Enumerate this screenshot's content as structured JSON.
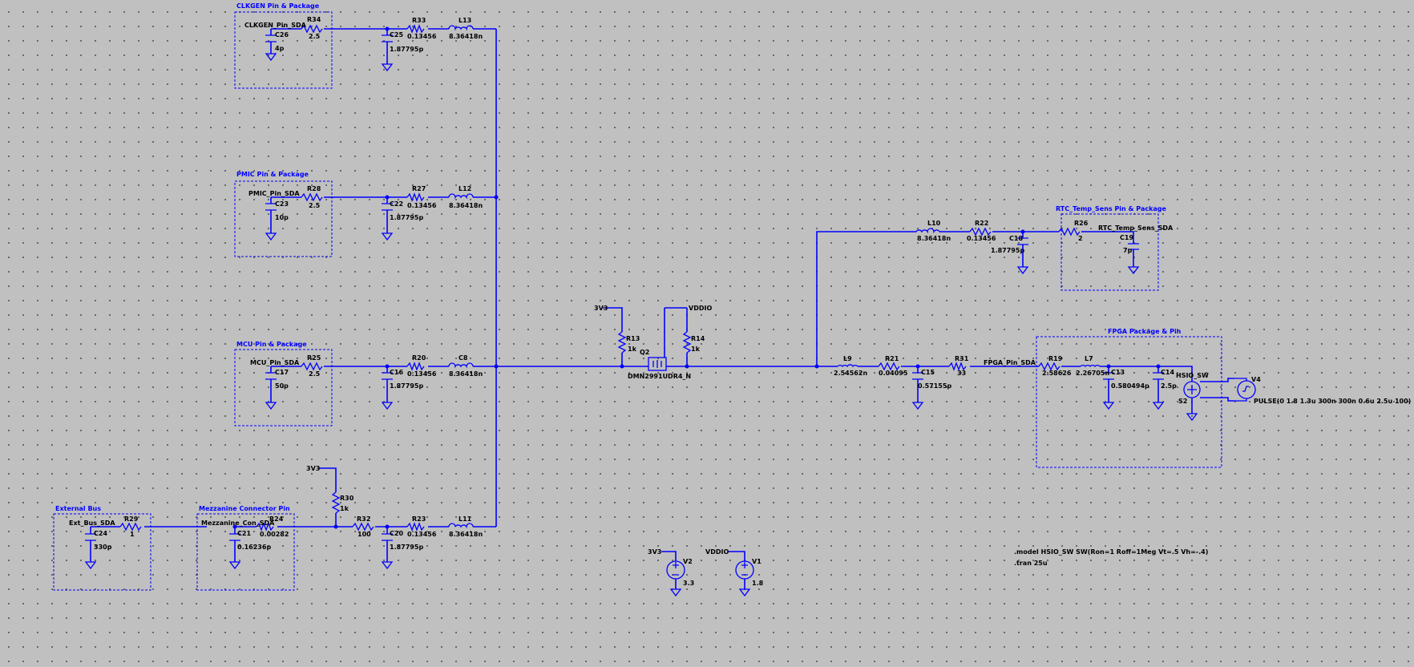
{
  "boxes": [
    {
      "title": "CLKGEN Pin & Package"
    },
    {
      "title": "PMIC Pin & Package"
    },
    {
      "title": "MCU Pin & Package"
    },
    {
      "title": "External Bus"
    },
    {
      "title": "Mezzanine Connector Pin"
    },
    {
      "title": "RTC_Temp_Sens Pin & Package"
    },
    {
      "title": "FPGA Package & Pin"
    }
  ],
  "net_labels": [
    "CLKGEN_Pin_SDA",
    "PMIC_Pin_SDA",
    "MCU_Pin_SDA",
    "Ext_Bus_SDA",
    "Mezzanine_Con_SDA",
    "RTC_Temp_Sens_SDA",
    "FPGA_Pin_SDA",
    "HSIO_SW"
  ],
  "power_labels": [
    "3V3",
    "VDDIO",
    "3V3",
    "3V3",
    "VDDIO"
  ],
  "components": [
    {
      "ref": "R34",
      "value": "2.5"
    },
    {
      "ref": "C26",
      "value": "4p"
    },
    {
      "ref": "C25",
      "value": "1.87795p"
    },
    {
      "ref": "R33",
      "value": "0.13456"
    },
    {
      "ref": "L13",
      "value": "8.36418n"
    },
    {
      "ref": "R28",
      "value": "2.5"
    },
    {
      "ref": "C23",
      "value": "10p"
    },
    {
      "ref": "C22",
      "value": "1.87795p"
    },
    {
      "ref": "R27",
      "value": "0.13456"
    },
    {
      "ref": "L12",
      "value": "8.36418n"
    },
    {
      "ref": "R25",
      "value": "2.5"
    },
    {
      "ref": "C17",
      "value": "50p"
    },
    {
      "ref": "C16",
      "value": "1.87795p"
    },
    {
      "ref": "R20",
      "value": "0.13456"
    },
    {
      "ref": "C8",
      "value": "8.36418n"
    },
    {
      "ref": "R29",
      "value": "1"
    },
    {
      "ref": "C24",
      "value": "330p"
    },
    {
      "ref": "R24",
      "value": "0.00282"
    },
    {
      "ref": "C21",
      "value": "0.16236p"
    },
    {
      "ref": "R30",
      "value": "1k"
    },
    {
      "ref": "R32",
      "value": "100"
    },
    {
      "ref": "C20",
      "value": "1.87795p"
    },
    {
      "ref": "R23",
      "value": "0.13456"
    },
    {
      "ref": "L11",
      "value": "8.36418n"
    },
    {
      "ref": "R13",
      "value": "1k"
    },
    {
      "ref": "R14",
      "value": "1k"
    },
    {
      "ref": "Q2",
      "value": "DMN2991UDR4_N"
    },
    {
      "ref": "L10",
      "value": "8.36418n"
    },
    {
      "ref": "R22",
      "value": "0.13456"
    },
    {
      "ref": "C18",
      "value": "1.87795p"
    },
    {
      "ref": "R26",
      "value": "2"
    },
    {
      "ref": "C19",
      "value": "7p"
    },
    {
      "ref": "L9",
      "value": "2.54562n"
    },
    {
      "ref": "R21",
      "value": "0.04095"
    },
    {
      "ref": "C15",
      "value": "0.57155p"
    },
    {
      "ref": "R31",
      "value": "33"
    },
    {
      "ref": "R19",
      "value": "2.58626"
    },
    {
      "ref": "L7",
      "value": "2.26705n"
    },
    {
      "ref": "C13",
      "value": "0.580494p"
    },
    {
      "ref": "C14",
      "value": "2.5p"
    },
    {
      "ref": "S2",
      "value": ""
    },
    {
      "ref": "V4",
      "value": "PULSE(0 1.8 1.3u 300n 300n 0.6u 2.5u 100)"
    },
    {
      "ref": "V2",
      "value": "3.3"
    },
    {
      "ref": "V1",
      "value": "1.8"
    }
  ],
  "directives": [
    ".model HSIO_SW SW(Ron=1 Roff=1Meg Vt=.5 Vh=-.4)",
    ".tran 25u"
  ],
  "colors": {
    "wire": "#0000ff",
    "background": "#c0c0c0",
    "text": "#000000",
    "box_title": "#0000ff"
  }
}
